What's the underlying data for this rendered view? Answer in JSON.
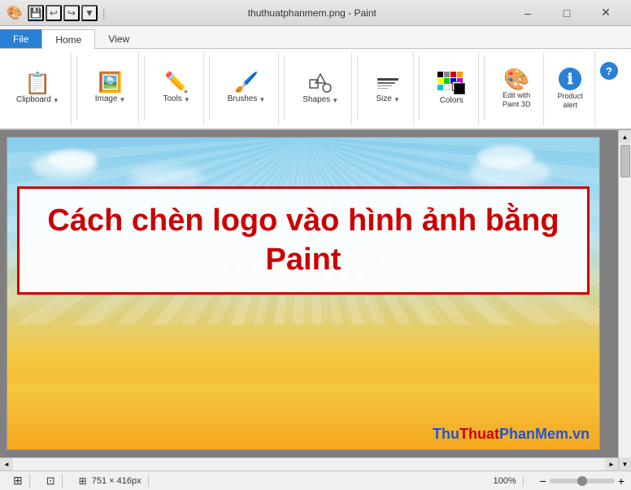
{
  "titlebar": {
    "title": "thuthuatphanmem.png - Paint",
    "minimize_label": "–",
    "maximize_label": "□",
    "close_label": "✕"
  },
  "quickaccess": {
    "save_label": "💾",
    "undo_label": "↩",
    "redo_label": "↪",
    "dropdown_label": "▼",
    "separator": "|"
  },
  "ribbon": {
    "file_tab": "File",
    "home_tab": "Home",
    "view_tab": "View",
    "groups": {
      "clipboard": {
        "label": "Clipboard",
        "arrow": "▼"
      },
      "image": {
        "label": "Image",
        "arrow": "▼"
      },
      "tools": {
        "label": "Tools",
        "arrow": "▼"
      },
      "brushes": {
        "label": "Brushes",
        "arrow": "▼"
      },
      "shapes": {
        "label": "Shapes",
        "arrow": "▼"
      },
      "size": {
        "label": "Size",
        "arrow": "▼"
      },
      "colors": {
        "label": "Colors"
      },
      "edit_with_paint3d": {
        "label": "Edit with\nPaint 3D"
      },
      "product_alert": {
        "label": "Product\nalert"
      }
    }
  },
  "canvas": {
    "image_text_line1": "Cách chèn logo vào hình ảnh bằng",
    "image_text_line2": "Paint",
    "watermark": {
      "part1": "Thu",
      "part2": "Thuat",
      "part3": "PhanMem.vn"
    }
  },
  "statusbar": {
    "dimensions": "751 × 416px",
    "zoom": "100%",
    "dimensions_icon": "⊞",
    "select_icon": "⊡"
  },
  "help": {
    "label": "?"
  }
}
